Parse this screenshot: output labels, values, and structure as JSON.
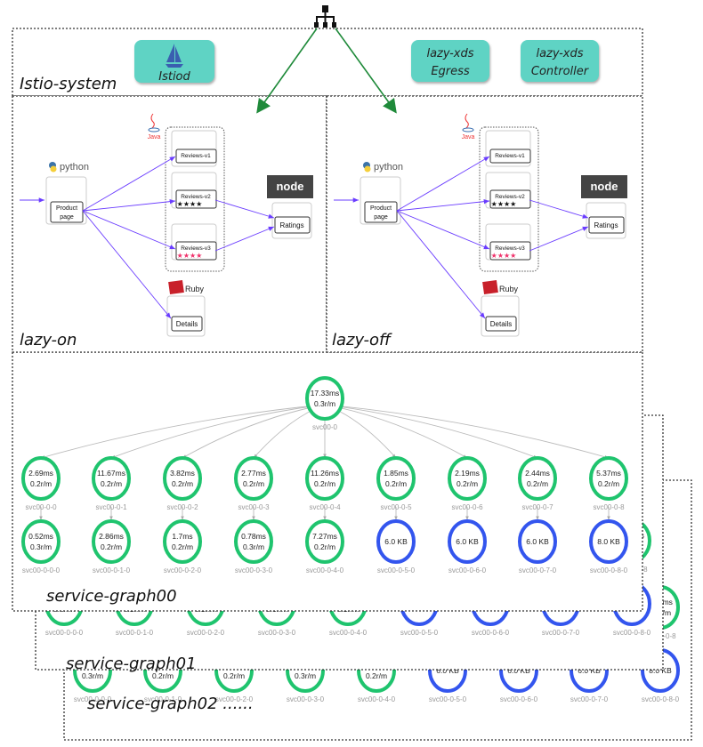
{
  "istio_system": {
    "label": "Istio-system",
    "components": [
      {
        "label": "Istiod",
        "icon": "istio-sail-icon"
      },
      {
        "label_line1": "lazy-xds",
        "label_line2": "Egress"
      },
      {
        "label_line1": "lazy-xds",
        "label_line2": "Controller"
      }
    ],
    "box_color": "#5fd3c4"
  },
  "namespaces": [
    {
      "label": "lazy-on"
    },
    {
      "label": "lazy-off"
    }
  ],
  "bookinfo": {
    "python_logo": "python",
    "java_logo": "Java",
    "ruby_logo": "Ruby",
    "node_logo": "node",
    "productpage": [
      "Product",
      "page"
    ],
    "reviews": [
      "Reviews-v1",
      "Reviews-v2",
      "Reviews-v3"
    ],
    "stars": "★★★★",
    "ratings": "Ratings",
    "details": "Details",
    "edge_color": "#6a3cff"
  },
  "arrow_color": "#1f8a3a",
  "service_graph": {
    "labels": [
      "service-graph00",
      "service-graph01",
      "service-graph02 ......"
    ],
    "colors": {
      "metric": "#1fc46e",
      "bytes": "#3355ee"
    },
    "root": {
      "name": "svc00-0",
      "latency": "17.33ms",
      "rate": "0.3r/m"
    },
    "level1": [
      {
        "name": "svc00-0-0",
        "latency": "2.69ms",
        "rate": "0.2r/m"
      },
      {
        "name": "svc00-0-1",
        "latency": "11.67ms",
        "rate": "0.2r/m"
      },
      {
        "name": "svc00-0-2",
        "latency": "3.82ms",
        "rate": "0.2r/m"
      },
      {
        "name": "svc00-0-3",
        "latency": "2.77ms",
        "rate": "0.2r/m"
      },
      {
        "name": "svc00-0-4",
        "latency": "11.26ms",
        "rate": "0.2r/m"
      },
      {
        "name": "svc00-0-5",
        "latency": "1.85ms",
        "rate": "0.2r/m"
      },
      {
        "name": "svc00-0-6",
        "latency": "2.19ms",
        "rate": "0.2r/m"
      },
      {
        "name": "svc00-0-7",
        "latency": "2.44ms",
        "rate": "0.2r/m"
      },
      {
        "name": "svc00-0-8",
        "latency": "5.37ms",
        "rate": "0.2r/m"
      }
    ],
    "level2": [
      {
        "name": "svc00-0-0-0",
        "latency": "0.52ms",
        "rate": "0.3r/m"
      },
      {
        "name": "svc00-0-1-0",
        "latency": "2.86ms",
        "rate": "0.2r/m"
      },
      {
        "name": "svc00-0-2-0",
        "latency": "1.7ms",
        "rate": "0.2r/m"
      },
      {
        "name": "svc00-0-3-0",
        "latency": "0.78ms",
        "rate": "0.3r/m"
      },
      {
        "name": "svc00-0-4-0",
        "latency": "7.27ms",
        "rate": "0.2r/m"
      },
      {
        "name": "svc00-0-5-0",
        "bytes": "6.0 KB"
      },
      {
        "name": "svc00-0-6-0",
        "bytes": "6.0 KB"
      },
      {
        "name": "svc00-0-7-0",
        "bytes": "6.0 KB"
      },
      {
        "name": "svc00-0-8-0",
        "bytes": "8.0 KB"
      }
    ]
  }
}
